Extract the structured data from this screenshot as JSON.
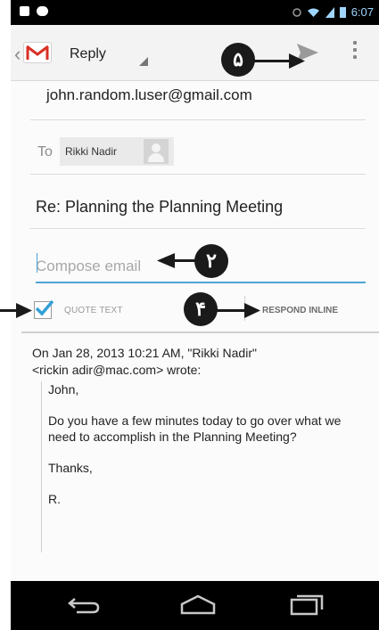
{
  "status_bar": {
    "time": "6:07",
    "icons": [
      "notification-icon",
      "voicemail-icon",
      "sync-icon",
      "wifi-icon",
      "signal-icon",
      "battery-icon"
    ]
  },
  "action_bar": {
    "mode_label": "Reply",
    "app_icon": "gmail-icon",
    "send_icon": "send-icon",
    "overflow_icon": "overflow-menu-icon"
  },
  "compose": {
    "from": "john.random.luser@gmail.com",
    "to_label": "To",
    "recipient_name": "Rikki Nadir",
    "subject": "Re: Planning the Planning Meeting",
    "body_placeholder": "Compose email",
    "quote_text_label": "QUOTE TEXT",
    "quote_text_checked": true,
    "respond_inline_label": "RESPOND INLINE"
  },
  "quoted": {
    "header_line1": "On Jan 28, 2013 10:21 AM, \"Rikki Nadir\"",
    "header_line2": "<rickin adir@mac.com> wrote:",
    "greeting": "John,",
    "body": "Do you have a few minutes today to go over what we need to accomplish in the Planning Meeting?",
    "closing": "Thanks,",
    "signature": "R."
  },
  "annotations": {
    "step_send": "۵",
    "step_compose": "۲",
    "step_respond_inline": "۴"
  },
  "colors": {
    "accent": "#4ea3d6",
    "badge": "#1a1a1a"
  }
}
